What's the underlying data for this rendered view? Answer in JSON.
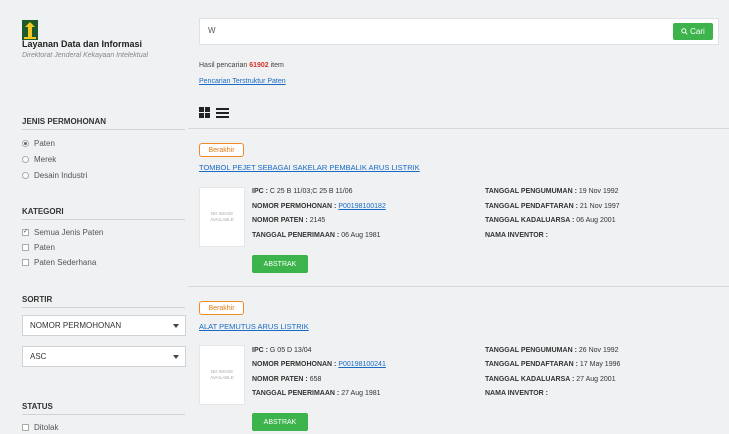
{
  "brand": {
    "title": "Layanan Data dan Informasi",
    "subtitle": "Direktorat Jenderal Kekayaan Intelektual"
  },
  "sidebar": {
    "jenis": {
      "title": "JENIS PERMOHONAN",
      "options": [
        {
          "label": "Paten",
          "selected": true
        },
        {
          "label": "Merek",
          "selected": false
        },
        {
          "label": "Desain Industri",
          "selected": false
        }
      ]
    },
    "kategori": {
      "title": "KATEGORI",
      "options": [
        {
          "label": "Semua Jenis Paten",
          "checked": true
        },
        {
          "label": "Paten",
          "checked": false
        },
        {
          "label": "Paten Sederhana",
          "checked": false
        }
      ]
    },
    "sortir": {
      "title": "SORTIR",
      "field": "NOMOR PERMOHONAN",
      "order": "ASC"
    },
    "status": {
      "title": "STATUS",
      "options": [
        {
          "label": "Ditolak",
          "checked": false
        }
      ]
    }
  },
  "search": {
    "value": "W",
    "button_label": "Cari",
    "icon": "search-icon"
  },
  "results": {
    "count_prefix": "Hasil pencarian ",
    "count": "61902",
    "count_suffix": " item",
    "structured_link": "Pencarian Terstruktur Paten",
    "items": [
      {
        "status": "Berakhir",
        "title": "TOMBOL PEJET SEBAGAI SAKELAR PEMBALIK ARUS LISTRIK",
        "thumb": "NO IMAGE AVAILABLE",
        "ipc_label": "IPC :",
        "ipc": "C 25 B 11/03;C 25 B 11/06",
        "nomor_permohonan_label": "NOMOR PERMOHONAN :",
        "nomor_permohonan": "P00198100182",
        "nomor_paten_label": "NOMOR PATEN :",
        "nomor_paten": "2145",
        "tgl_penerimaan_label": "TANGGAL PENERIMAAN :",
        "tgl_penerimaan": "06 Aug 1981",
        "tgl_pengumuman_label": "TANGGAL PENGUMUMAN :",
        "tgl_pengumuman": "19 Nov 1992",
        "tgl_pendaftaran_label": "TANGGAL PENDAFTARAN :",
        "tgl_pendaftaran": "21 Nov 1997",
        "tgl_kadaluarsa_label": "TANGGAL KADALUARSA :",
        "tgl_kadaluarsa": "06 Aug 2001",
        "inventor_label": "NAMA INVENTOR :",
        "inventor": "",
        "abstrak_label": "ABSTRAK"
      },
      {
        "status": "Berakhir",
        "title": "ALAT PEMUTUS ARUS LISTRIK",
        "thumb": "NO IMAGE AVAILABLE",
        "ipc_label": "IPC :",
        "ipc": "G 05 D 13/04",
        "nomor_permohonan_label": "NOMOR PERMOHONAN :",
        "nomor_permohonan": "P00198100241",
        "nomor_paten_label": "NOMOR PATEN :",
        "nomor_paten": "658",
        "tgl_penerimaan_label": "TANGGAL PENERIMAAN :",
        "tgl_penerimaan": "27 Aug 1981",
        "tgl_pengumuman_label": "TANGGAL PENGUMUMAN :",
        "tgl_pengumuman": "26 Nov 1992",
        "tgl_pendaftaran_label": "TANGGAL PENDAFTARAN :",
        "tgl_pendaftaran": "17 May 1996",
        "tgl_kadaluarsa_label": "TANGGAL KADALUARSA :",
        "tgl_kadaluarsa": "27 Aug 2001",
        "inventor_label": "NAMA INVENTOR :",
        "inventor": "",
        "abstrak_label": "ABSTRAK"
      }
    ]
  },
  "colors": {
    "accent_green": "#3cb44b",
    "status_orange": "#f08a24",
    "link_blue": "#1a6bc4",
    "count_red": "#d9342b"
  }
}
